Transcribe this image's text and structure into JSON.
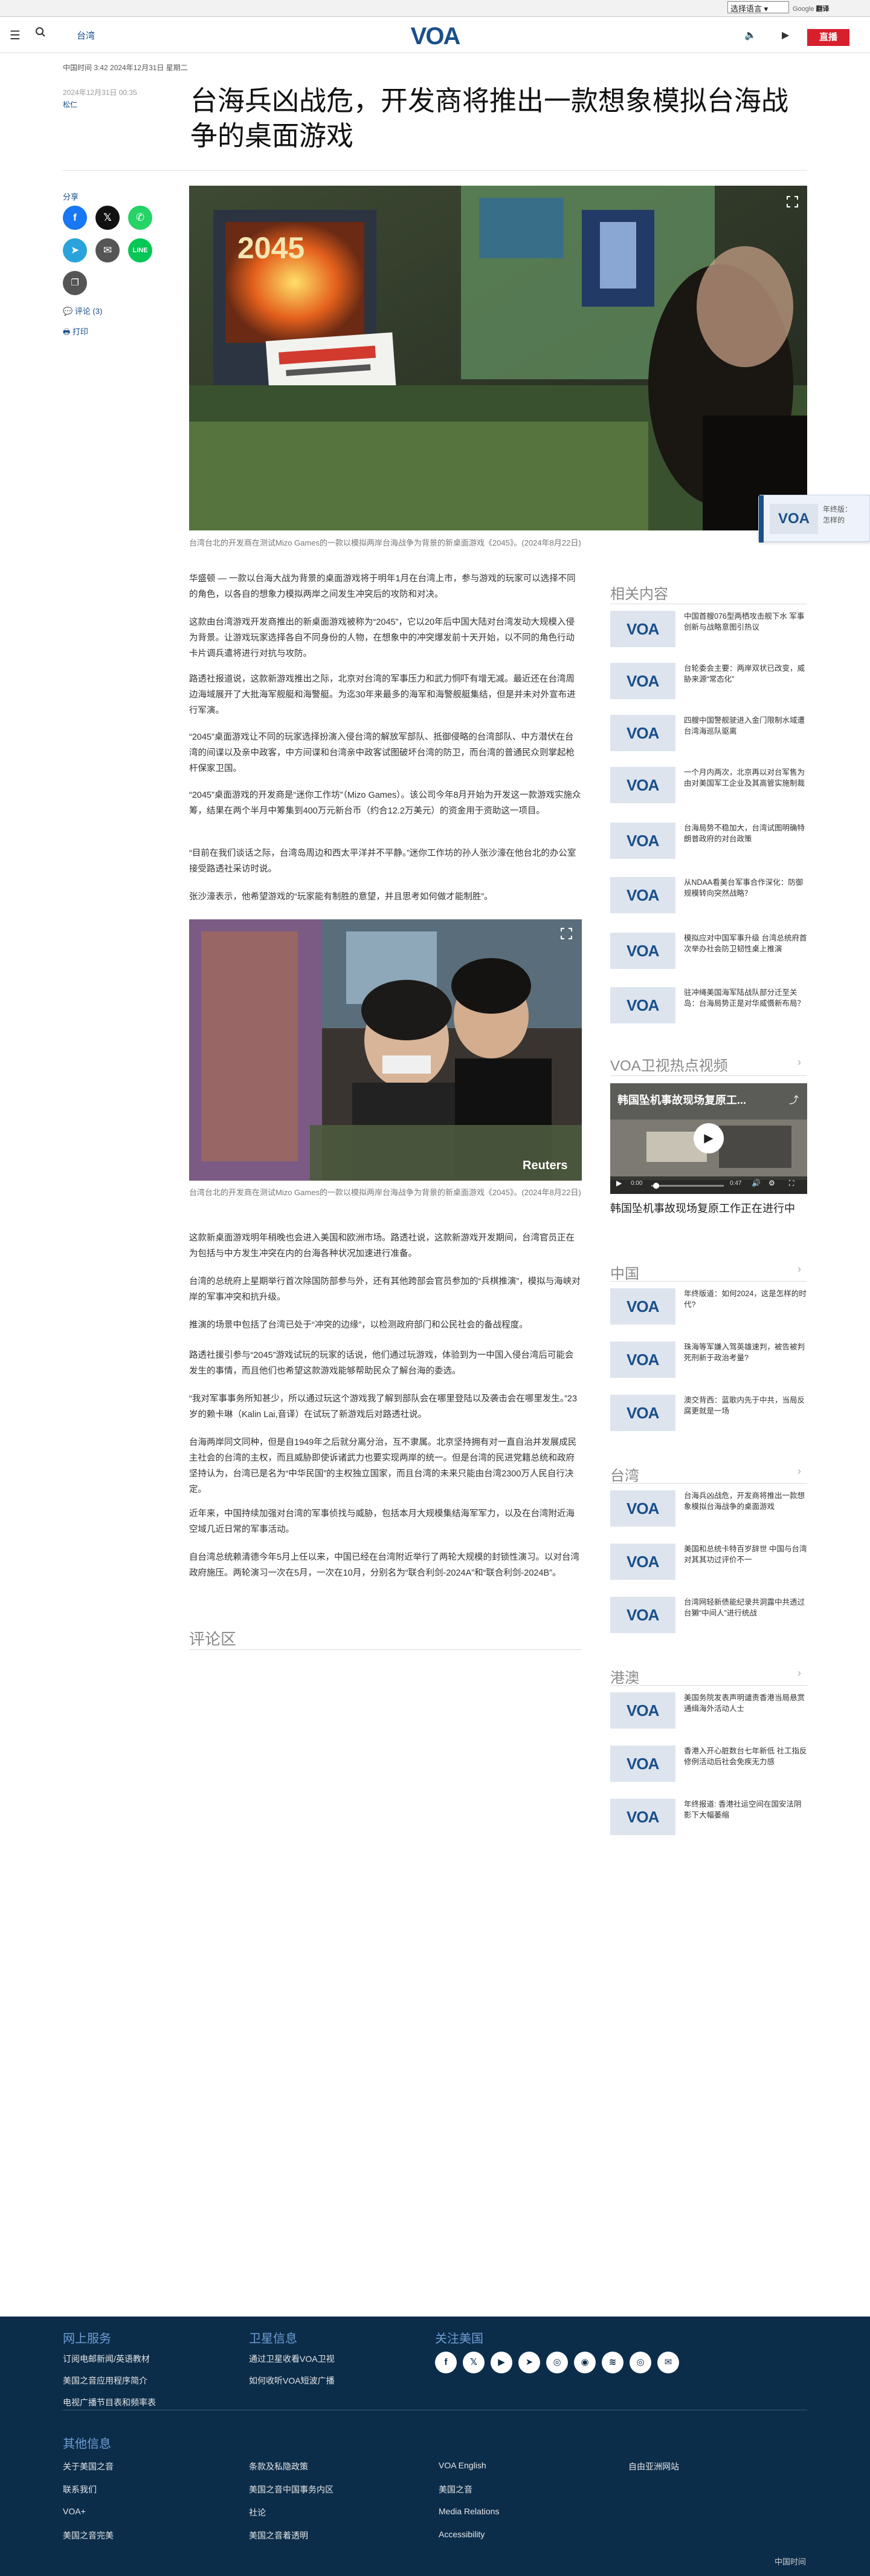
{
  "topbar": {
    "language_select": "选择语言",
    "google_translate": "Google",
    "translate_word": "翻译"
  },
  "header": {
    "brand": "台湾",
    "logo": "VOA",
    "live": "直播"
  },
  "article": {
    "meta": "中国时间 3:42 2024年12月31日 星期二",
    "date": "2024年12月31日 00:35",
    "author": "松仁",
    "title": "台海兵凶战危，开发商将推出一款想象模拟台海战争的桌面游戏",
    "hero_caption": "台湾台北的开发商在测试Mizo Games的一款以模拟两岸台海战争为背景的新桌面游戏《2045》。(2024年8月22日)",
    "inline_caption": "台湾台北的开发商在测试Mizo Games的一款以模拟两岸台海战争为背景的新桌面游戏《2045》。(2024年8月22日)",
    "reuters": "Reuters",
    "box_title": "2045",
    "paragraphs_top": [
      "华盛顿 — 一款以台海大战为背景的桌面游戏将于明年1月在台湾上市，参与游戏的玩家可以选择不同的角色，以各自的想象力模拟两岸之间发生冲突后的攻防和对决。",
      "这款由台湾游戏开发商推出的新桌面游戏被称为“2045”，它以20年后中国大陆对台湾发动大规模入侵为背景。让游戏玩家选择各自不同身份的人物，在想象中的冲突爆发前十天开始，以不同的角色行动卡片调兵遣将进行对抗与攻防。",
      "路透社报道说，这款新游戏推出之际，北京对台湾的军事压力和武力恫吓有增无减。最近还在台湾周边海域展开了大批海军舰艇和海警艇。为迄30年来最多的海军和海警舰艇集结，但是并未对外宣布进行军演。",
      "“2045”桌面游戏让不同的玩家选择扮演入侵台湾的解放军部队、抵御侵略的台湾部队、中方潜伏在台湾的间谍以及亲中政客，中方间谍和台湾亲中政客试图破坏台湾的防卫，而台湾的普通民众则掌起枪杆保家卫国。",
      "“2045”桌面游戏的开发商是“迷你工作坊”（Mizo Games）。该公司今年8月开始为开发这一款游戏实施众筹，结果在两个半月中筹集到400万元新台币（约合12.2万美元）的资金用于资助这一项目。",
      "“目前在我们谈话之际，台湾岛周边和西太平洋并不平静。”迷你工作坊的孙人张沙濠在他台北的办公室接受路透社采访时说。",
      "张沙濠表示，他希望游戏的“玩家能有制胜的意望，并且思考如何做才能制胜”。"
    ],
    "paragraphs_bottom": [
      "这款新桌面游戏明年稍晚也会进入美国和欧洲市场。路透社说，这款新游戏开发期间，台湾官员正在为包括与中方发生冲突在内的台海各种状况加速进行准备。",
      "台湾的总统府上星期举行首次除国防部参与外，还有其他跨部会官员参加的“兵棋推演”，模拟与海峡对岸的军事冲突和抗升级。",
      "推演的场景中包括了台湾已处于“冲突的边缘”，以检测政府部门和公民社会的备战程度。",
      "路透社援引参与“2045”游戏试玩的玩家的话说，他们通过玩游戏，体验到为一中国入侵台湾后可能会发生的事情，而且他们也希望这款游戏能够帮助民众了解台海的委选。",
      "“我对军事事务所知甚少，所以通过玩这个游戏我了解到部队会在哪里登陆以及袭击会在哪里发生。”23岁的赖卡琳（Kalin Lai,音译）在试玩了新游戏后对路透社说。",
      "台海两岸同文同种，但是自1949年之后就分离分治，互不隶属。北京坚持拥有对一直自治并发展成民主社会的台湾的主权，而且威胁即使诉诸武力也要实现两岸的统一。但是台湾的民进党籍总统和政府坚持认为，台湾已是名为“中华民国”的主权独立国家，而且台湾的未来只能由台湾2300万人民自行决定。",
      "近年来，中国持续加强对台湾的军事侦找与威胁，包括本月大规模集结海军军力，以及在台湾附近海空域几近日常的军事活动。",
      "自台湾总统赖清德今年5月上任以来，中国已经在台湾附近举行了两轮大规模的封锁性演习。以对台湾政府施压。两轮演习一次在5月，一次在10月，分别名为“联合利剑-2024A”和“联合利剑-2024B”。"
    ],
    "comments_heading": "评论区"
  },
  "share": {
    "label": "分享",
    "comments": "评论 (3)",
    "print": "打印"
  },
  "float_card": {
    "line1": "年终版：",
    "line2": "怎样的"
  },
  "sidebar": {
    "related_heading": "相关内容",
    "related": [
      "中国首艘076型两栖攻击舰下水 军事创新与战略意图引热议",
      "台轮委会主要：两岸双状已改变，威胁来源“常态化”",
      "四艘中国警舰驶进入金门限制水域遭台湾海巡队驱离",
      "一个月内两次，北京再以对台军售为由对美国军工企业及其高管实施制裁",
      "台海局势不稳加大，台湾试图明确特朗普政府的对台政策",
      "从NDAA看美台军事合作深化：防御规模转向突然战略？",
      "模拟应对中国军事升级 台湾总统府首次举办社会防卫韧性桌上推演",
      "驻冲绳美国海军陆战队部分迁至关岛：台海局势正是对华威慑新布局？"
    ],
    "video_heading": "VOA卫视热点视频",
    "video_overlay": "韩国坠机事故现场复原工...",
    "video_time": "0:47",
    "video_start": "0:00",
    "video_title": "韩国坠机事故现场复原工作正在进行中",
    "china_heading": "中国",
    "china": [
      "年终版道：如何2024，这是怎样的时代?",
      "珠海等军嫌入驾英雄速判，被告被判死刑新于政治考量?",
      "澳交背西：蓝歌内先于中共，当局反腐更就是一场"
    ],
    "taiwan_heading": "台湾",
    "taiwan": [
      "台海兵凶战危，开发商将推出一款想象模拟台海战争的桌面游戏",
      "美国和总统卡特百岁辞世 中国与台湾对其其功过评价不一",
      "台湾网轻新债能纪录共洞露中共透过台獭“中间人”进行统战"
    ],
    "hk_heading": "港澳",
    "hk": [
      "美国务院发表声明谴责香港当局悬赏通缉海外活动人士",
      "香港入开心脏数台七年新低 社工指反修例活动后社会免疾无力感",
      "年终报道: 香港社运空间在国安法阴影下大幅萎缩"
    ]
  },
  "footer": {
    "online_heading": "网上服务",
    "online": [
      "订阅电邮新闻/英语教材",
      "美国之音应用程序简介",
      "电视广播节目表和频率表"
    ],
    "voa_heading": "卫星信息",
    "voa": [
      "通过卫星收看VOA卫视",
      "如何收听VOA短波广播"
    ],
    "follow_heading": "关注美国",
    "social_icons": [
      "facebook-icon",
      "x-icon",
      "youtube-icon",
      "telegram-icon",
      "instagram-icon",
      "podcast-icon",
      "rss-icon",
      "podcast-icon-2",
      "email-icon"
    ],
    "other_heading": "其他信息",
    "other_col1": [
      "关于美国之音",
      "联系我们",
      "VOA+",
      "美国之音完美"
    ],
    "other_col2": [
      "条款及私隐政策",
      "美国之音中国事务内区",
      "社论",
      "美国之音着透明"
    ],
    "other_col3": [
      "VOA English",
      "美国之音",
      "Media Relations",
      "Accessibility"
    ],
    "other_col4": [
      "自由亚洲网站"
    ],
    "copyright": "中国时间"
  }
}
